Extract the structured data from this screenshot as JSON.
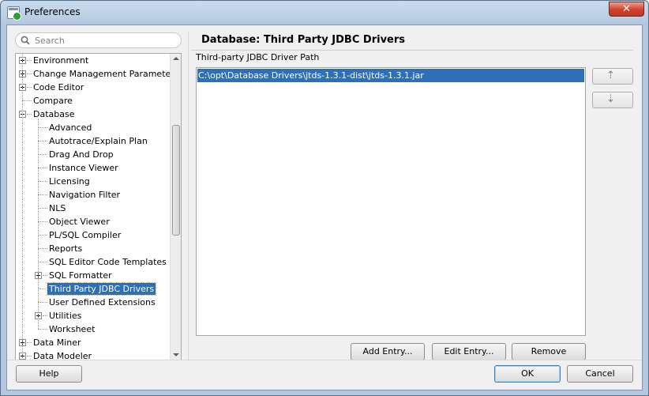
{
  "window": {
    "title": "Preferences",
    "close_glyph": "✕"
  },
  "search": {
    "placeholder": "Search",
    "value": ""
  },
  "tree": {
    "items": [
      {
        "label": "Environment",
        "level": 0,
        "toggle": "plus"
      },
      {
        "label": "Change Management Parameters",
        "level": 0,
        "toggle": "plus"
      },
      {
        "label": "Code Editor",
        "level": 0,
        "toggle": "plus"
      },
      {
        "label": "Compare",
        "level": 0,
        "toggle": "none"
      },
      {
        "label": "Database",
        "level": 0,
        "toggle": "minus"
      },
      {
        "label": "Advanced",
        "level": 1,
        "toggle": "none"
      },
      {
        "label": "Autotrace/Explain Plan",
        "level": 1,
        "toggle": "none"
      },
      {
        "label": "Drag And Drop",
        "level": 1,
        "toggle": "none"
      },
      {
        "label": "Instance Viewer",
        "level": 1,
        "toggle": "none"
      },
      {
        "label": "Licensing",
        "level": 1,
        "toggle": "none"
      },
      {
        "label": "Navigation Filter",
        "level": 1,
        "toggle": "none"
      },
      {
        "label": "NLS",
        "level": 1,
        "toggle": "none"
      },
      {
        "label": "Object Viewer",
        "level": 1,
        "toggle": "none"
      },
      {
        "label": "PL/SQL Compiler",
        "level": 1,
        "toggle": "none"
      },
      {
        "label": "Reports",
        "level": 1,
        "toggle": "none"
      },
      {
        "label": "SQL Editor Code Templates",
        "level": 1,
        "toggle": "none"
      },
      {
        "label": "SQL Formatter",
        "level": 1,
        "toggle": "plus"
      },
      {
        "label": "Third Party JDBC Drivers",
        "level": 1,
        "toggle": "none",
        "selected": true
      },
      {
        "label": "User Defined Extensions",
        "level": 1,
        "toggle": "none"
      },
      {
        "label": "Utilities",
        "level": 1,
        "toggle": "plus"
      },
      {
        "label": "Worksheet",
        "level": 1,
        "toggle": "none"
      },
      {
        "label": "Data Miner",
        "level": 0,
        "toggle": "plus"
      },
      {
        "label": "Data Modeler",
        "level": 0,
        "toggle": "plus"
      }
    ]
  },
  "page": {
    "title": "Database: Third Party JDBC Drivers",
    "section_label": "Third-party JDBC Driver Path",
    "entries": [
      "C:\\opt\\Database Drivers\\jtds-1.3.1-dist\\jtds-1.3.1.jar"
    ],
    "move_up_glyph": "⇡",
    "move_down_glyph": "⇣",
    "add_label": "Add Entry...",
    "edit_label": "Edit Entry...",
    "remove_label": "Remove"
  },
  "footer": {
    "help_label": "Help",
    "ok_label": "OK",
    "cancel_label": "Cancel"
  },
  "colors": {
    "selection": "#2e6fb5",
    "titlebar": "#c9dbee",
    "close_button": "#d1402b"
  }
}
